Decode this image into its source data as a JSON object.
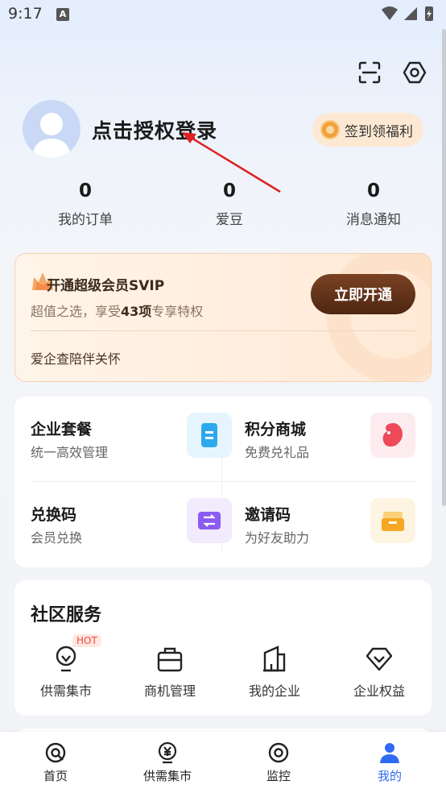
{
  "status_bar": {
    "time": "9:17",
    "notif_icon_text": "A"
  },
  "header": {
    "scan_icon": "scan-icon",
    "settings_icon": "settings-hex-icon",
    "login_text": "点击授权登录",
    "signin_label": "签到领福利"
  },
  "stats": [
    {
      "value": "0",
      "label": "我的订单"
    },
    {
      "value": "0",
      "label": "爱豆"
    },
    {
      "value": "0",
      "label": "消息通知"
    }
  ],
  "vip": {
    "title": "开通超级会员SVIP",
    "sub_prefix": "超值之选，享受",
    "sub_highlight": "43项",
    "sub_suffix": "专享特权",
    "button": "立即开通",
    "footer": "爱企查陪伴关怀"
  },
  "services": [
    {
      "title": "企业套餐",
      "sub": "统一高效管理",
      "color": "#2ea8ec"
    },
    {
      "title": "积分商城",
      "sub": "免费兑礼品",
      "color": "#ee4a5a"
    },
    {
      "title": "兑换码",
      "sub": "会员兑换",
      "color": "#8a5cf0"
    },
    {
      "title": "邀请码",
      "sub": "为好友助力",
      "color": "#f6a723"
    }
  ],
  "community": {
    "title": "社区服务",
    "hot_badge": "HOT",
    "items": [
      {
        "label": "供需集市",
        "icon": "lightbulb-icon"
      },
      {
        "label": "商机管理",
        "icon": "briefcase-icon"
      },
      {
        "label": "我的企业",
        "icon": "building-icon"
      },
      {
        "label": "企业权益",
        "icon": "diamond-icon"
      }
    ]
  },
  "tabbar": {
    "items": [
      {
        "label": "首页",
        "icon": "home-search-icon"
      },
      {
        "label": "供需集市",
        "icon": "yen-icon"
      },
      {
        "label": "监控",
        "icon": "monitor-icon"
      },
      {
        "label": "我的",
        "icon": "person-icon"
      }
    ],
    "active_index": 3,
    "active_color": "#2f6bf2"
  },
  "colors": {
    "accent": "#2f6bf2",
    "vip_button": "#5e2f16",
    "arrow": "#e02020"
  }
}
